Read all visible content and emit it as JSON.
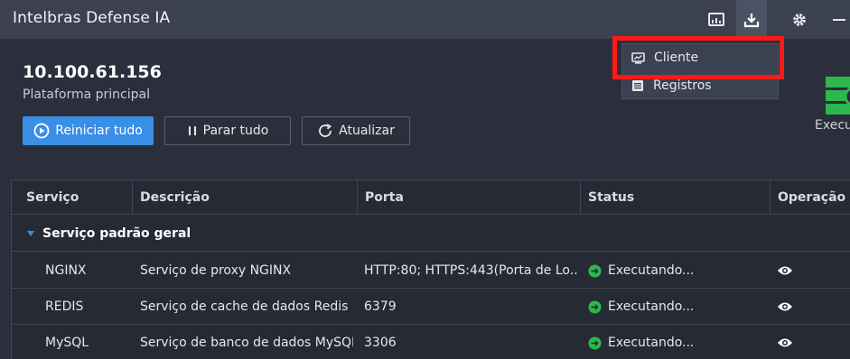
{
  "app": {
    "title": "Intelbras Defense IA"
  },
  "titlebar_icons": [
    "monitor-icon",
    "download-icon",
    "gear-icon",
    "minimize-icon"
  ],
  "server": {
    "ip": "10.100.61.156",
    "role": "Plataforma principal"
  },
  "actions": {
    "restart_all": "Reiniciar tudo",
    "stop_all": "Parar tudo",
    "refresh": "Atualizar"
  },
  "side_status": "Execu",
  "download_menu": {
    "items": [
      {
        "label": "Cliente",
        "icon": "monitor-chart-icon"
      },
      {
        "label": "Registros",
        "icon": "list-icon"
      }
    ]
  },
  "table": {
    "headers": [
      "Serviço",
      "Descrição",
      "Porta",
      "Status",
      "Operação"
    ],
    "group": "Serviço padrão geral",
    "rows": [
      {
        "service": "NGINX",
        "description": "Serviço de proxy NGINX",
        "port": "HTTP:80; HTTPS:443(Porta de Lo...",
        "status": "Executando..."
      },
      {
        "service": "REDIS",
        "description": "Serviço de cache de dados Redis",
        "port": "6379",
        "status": "Executando..."
      },
      {
        "service": "MySQL",
        "description": "Serviço de banco de dados MySQL",
        "port": "3306",
        "status": "Executando..."
      }
    ]
  },
  "colors": {
    "accent": "#3a8ee6",
    "running": "#2db84d",
    "highlight": "#ff1a1a",
    "titlebar": "#3b4150",
    "background": "#2a2f3b"
  }
}
